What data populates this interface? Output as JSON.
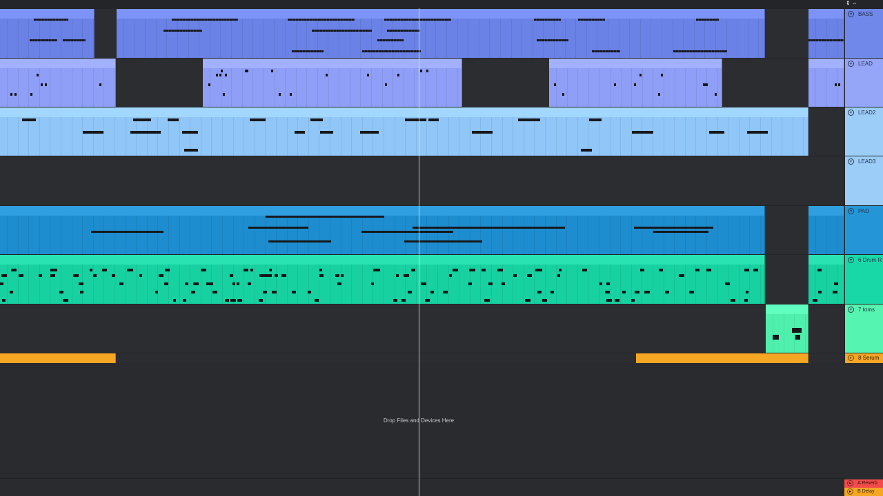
{
  "tracks": [
    {
      "name": "BASS",
      "color": "#6a82e6",
      "header_color": "#6f88ea"
    },
    {
      "name": "LEAD",
      "color": "#8f9ff7",
      "header_color": "#95a5f8"
    },
    {
      "name": "LEAD2",
      "color": "#90c6f8",
      "header_color": "#9ccdf8"
    },
    {
      "name": "LEAD3",
      "color": "#90c6f8",
      "header_color": "#9ccdf8"
    },
    {
      "name": "PAD",
      "color": "#1d8dcf",
      "header_color": "#2496d8"
    },
    {
      "name": "6 Drum R",
      "color": "#17d1a1",
      "header_color": "#19d8a8"
    },
    {
      "name": "7 toms",
      "color": "#4ff0ad",
      "header_color": "#55f4b0"
    },
    {
      "name": "8 Serum",
      "color": "#f5a623",
      "header_color": "#f5a623"
    }
  ],
  "sends": [
    {
      "name": "A Reverb",
      "color": "#f24b4b"
    },
    {
      "name": "B Delay",
      "color": "#f5a623"
    }
  ],
  "drop_text": "Drop Files and Devices Here",
  "corner_icons": "⇕ ⇔"
}
